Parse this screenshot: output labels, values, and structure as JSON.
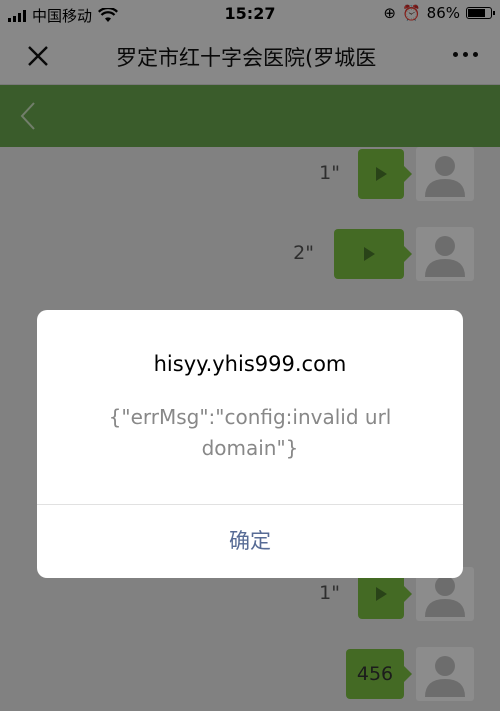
{
  "status_bar": {
    "carrier": "中国移动",
    "time": "15:27",
    "battery_percent": "86%",
    "battery_level": 0.86
  },
  "nav": {
    "title": "罗定市红十字会医院(罗城医"
  },
  "chat": {
    "messages": [
      {
        "type": "voice",
        "duration": "1\""
      },
      {
        "type": "voice",
        "duration": "2\""
      },
      {
        "type": "voice",
        "duration": "1\""
      },
      {
        "type": "text",
        "text": "456"
      }
    ]
  },
  "dialog": {
    "title": "hisyy.yhis999.com",
    "message": "{\"errMsg\":\"config:invalid url domain\"}",
    "confirm_label": "确定"
  },
  "colors": {
    "header_green": "#6aa84f",
    "bubble_green": "#7dc242",
    "confirm_blue": "#576b95"
  }
}
